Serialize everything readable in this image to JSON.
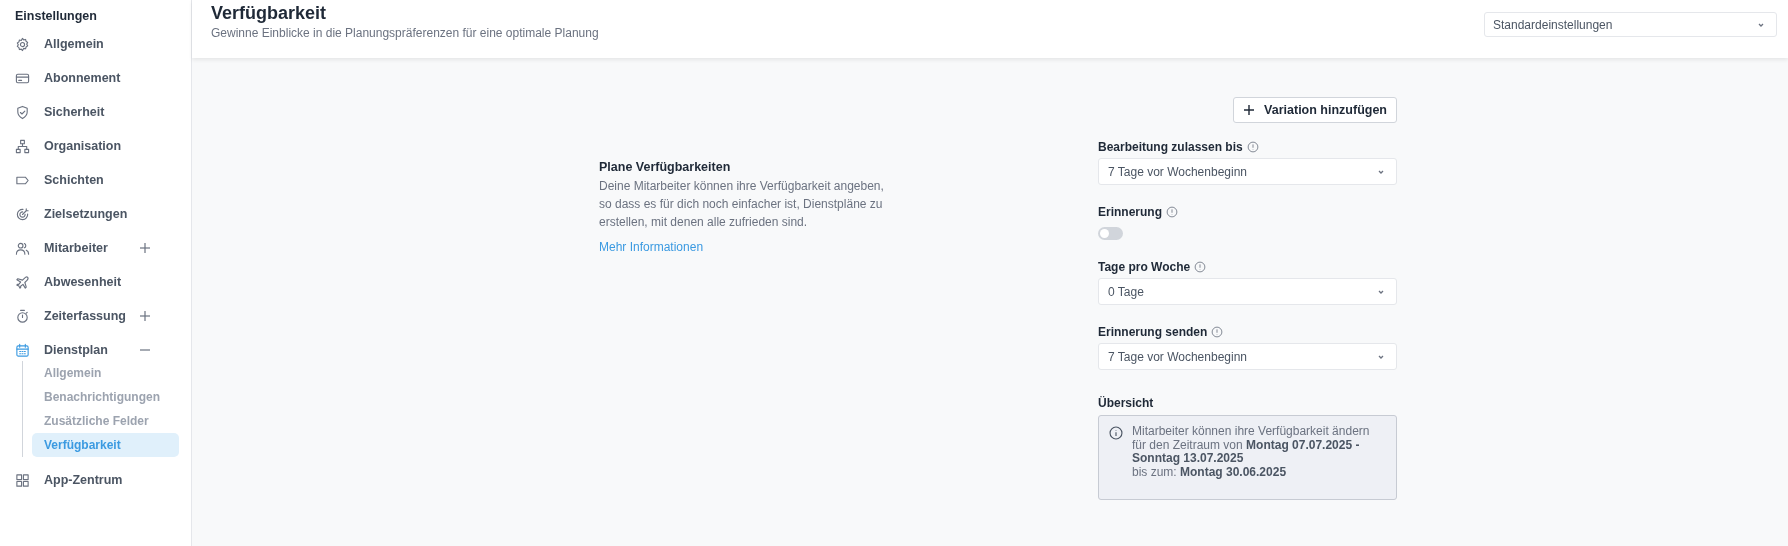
{
  "sidebar": {
    "title": "Einstellungen",
    "items": [
      {
        "label": "Allgemein"
      },
      {
        "label": "Abonnement"
      },
      {
        "label": "Sicherheit"
      },
      {
        "label": "Organisation"
      },
      {
        "label": "Schichten"
      },
      {
        "label": "Zielsetzungen"
      },
      {
        "label": "Mitarbeiter",
        "expanded": false
      },
      {
        "label": "Abwesenheit"
      },
      {
        "label": "Zeiterfassung",
        "expanded": false
      },
      {
        "label": "Dienstplan",
        "expanded": true,
        "children": [
          {
            "label": "Allgemein",
            "selected": false
          },
          {
            "label": "Benachrichtigungen",
            "selected": false
          },
          {
            "label": "Zusätzliche Felder",
            "selected": false
          },
          {
            "label": "Verfügbarkeit",
            "selected": true
          }
        ]
      },
      {
        "label": "App-Zentrum"
      }
    ]
  },
  "header": {
    "title": "Verfügbarkeit",
    "subtitle": "Gewinne Einblicke in die Planungspräferenzen für eine optimale Planung",
    "preset": "Standardeinstellungen"
  },
  "add_button": "Variation hinzufügen",
  "intro": {
    "title": "Plane Verfügbarkeiten",
    "text": "Deine Mitarbeiter können ihre Verfügbarkeit angeben, so dass es für dich noch einfacher ist, Dienstpläne zu erstellen, mit denen alle zufrieden sind.",
    "link": "Mehr Informationen"
  },
  "fields": [
    {
      "kind": "select",
      "label": "Bearbeitung zulassen bis",
      "value": "7 Tage vor Wochenbeginn"
    },
    {
      "kind": "toggle",
      "label": "Erinnerung",
      "on": false
    },
    {
      "kind": "select",
      "label": "Tage pro Woche",
      "value": "0 Tage"
    },
    {
      "kind": "select",
      "label": "Erinnerung senden",
      "value": "7 Tage vor Wochenbeginn"
    }
  ],
  "overview": {
    "title": "Übersicht",
    "lines": [
      "Mitarbeiter können ihre Verfügbarkeit ändern für den Zeitraum von **Montag 07.07.2025 - Sonntag 13.07.2025**",
      "bis zum: **Montag 30.06.2025**"
    ]
  }
}
